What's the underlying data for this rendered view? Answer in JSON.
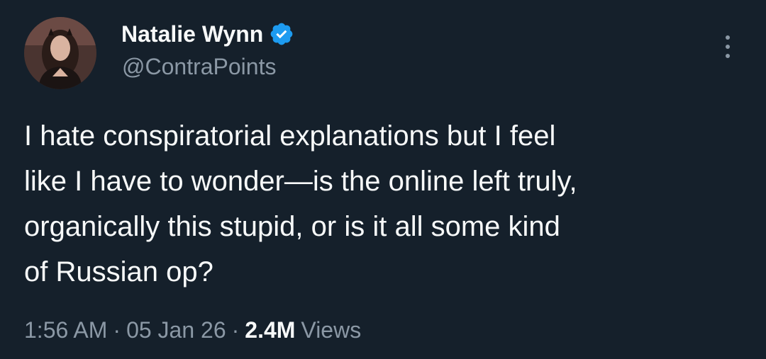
{
  "author": {
    "display_name": "Natalie Wynn",
    "handle": "@ContraPoints",
    "verified_icon": "verified-badge-icon",
    "verified_color": "#1d9bf0"
  },
  "tweet": {
    "text": "I hate conspiratorial explanations but I feel\nlike I have to wonder—is the online left truly,\norganically this stupid, or is it all some kind\nof Russian op?"
  },
  "meta": {
    "time": "1:56 AM",
    "separator": "·",
    "date": "05 Jan 26",
    "view_count": "2.4M",
    "views_label": "Views"
  },
  "menu": {
    "icon": "more-options-icon"
  },
  "colors": {
    "background": "#15202b",
    "primary_text": "#f7f9f9",
    "secondary_text": "#8b98a5"
  }
}
